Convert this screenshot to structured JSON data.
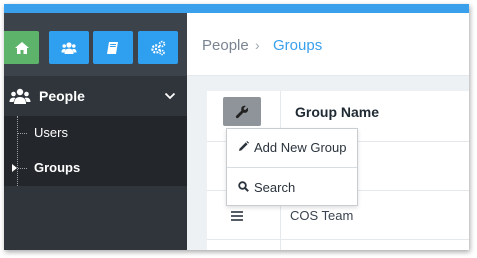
{
  "breadcrumb": {
    "parent": "People",
    "separator": "›",
    "current": "Groups"
  },
  "toolbar": {
    "buttons": [
      {
        "icon": "home-icon",
        "color": "#5eb36a"
      },
      {
        "icon": "users-icon",
        "color": "#2f9ff0"
      },
      {
        "icon": "book-icon",
        "color": "#2f9ff0"
      },
      {
        "icon": "gears-icon",
        "color": "#2f9ff0"
      }
    ]
  },
  "sidebar": {
    "section": {
      "label": "People",
      "icon": "users-icon",
      "expanded": true
    },
    "items": [
      {
        "label": "Users",
        "active": false
      },
      {
        "label": "Groups",
        "active": true
      }
    ]
  },
  "table": {
    "column_header": "Group Name",
    "rows": [
      {
        "name": "COS Team"
      }
    ]
  },
  "dropdown": {
    "items": [
      {
        "label": "Add New Group",
        "icon": "pencil-icon"
      },
      {
        "label": "Search",
        "icon": "search-icon"
      }
    ]
  },
  "colors": {
    "accent": "#3aa0ec",
    "sidebar_bg": "#2f353b",
    "subnav_bg": "#23272b",
    "home_green": "#5eb36a"
  }
}
